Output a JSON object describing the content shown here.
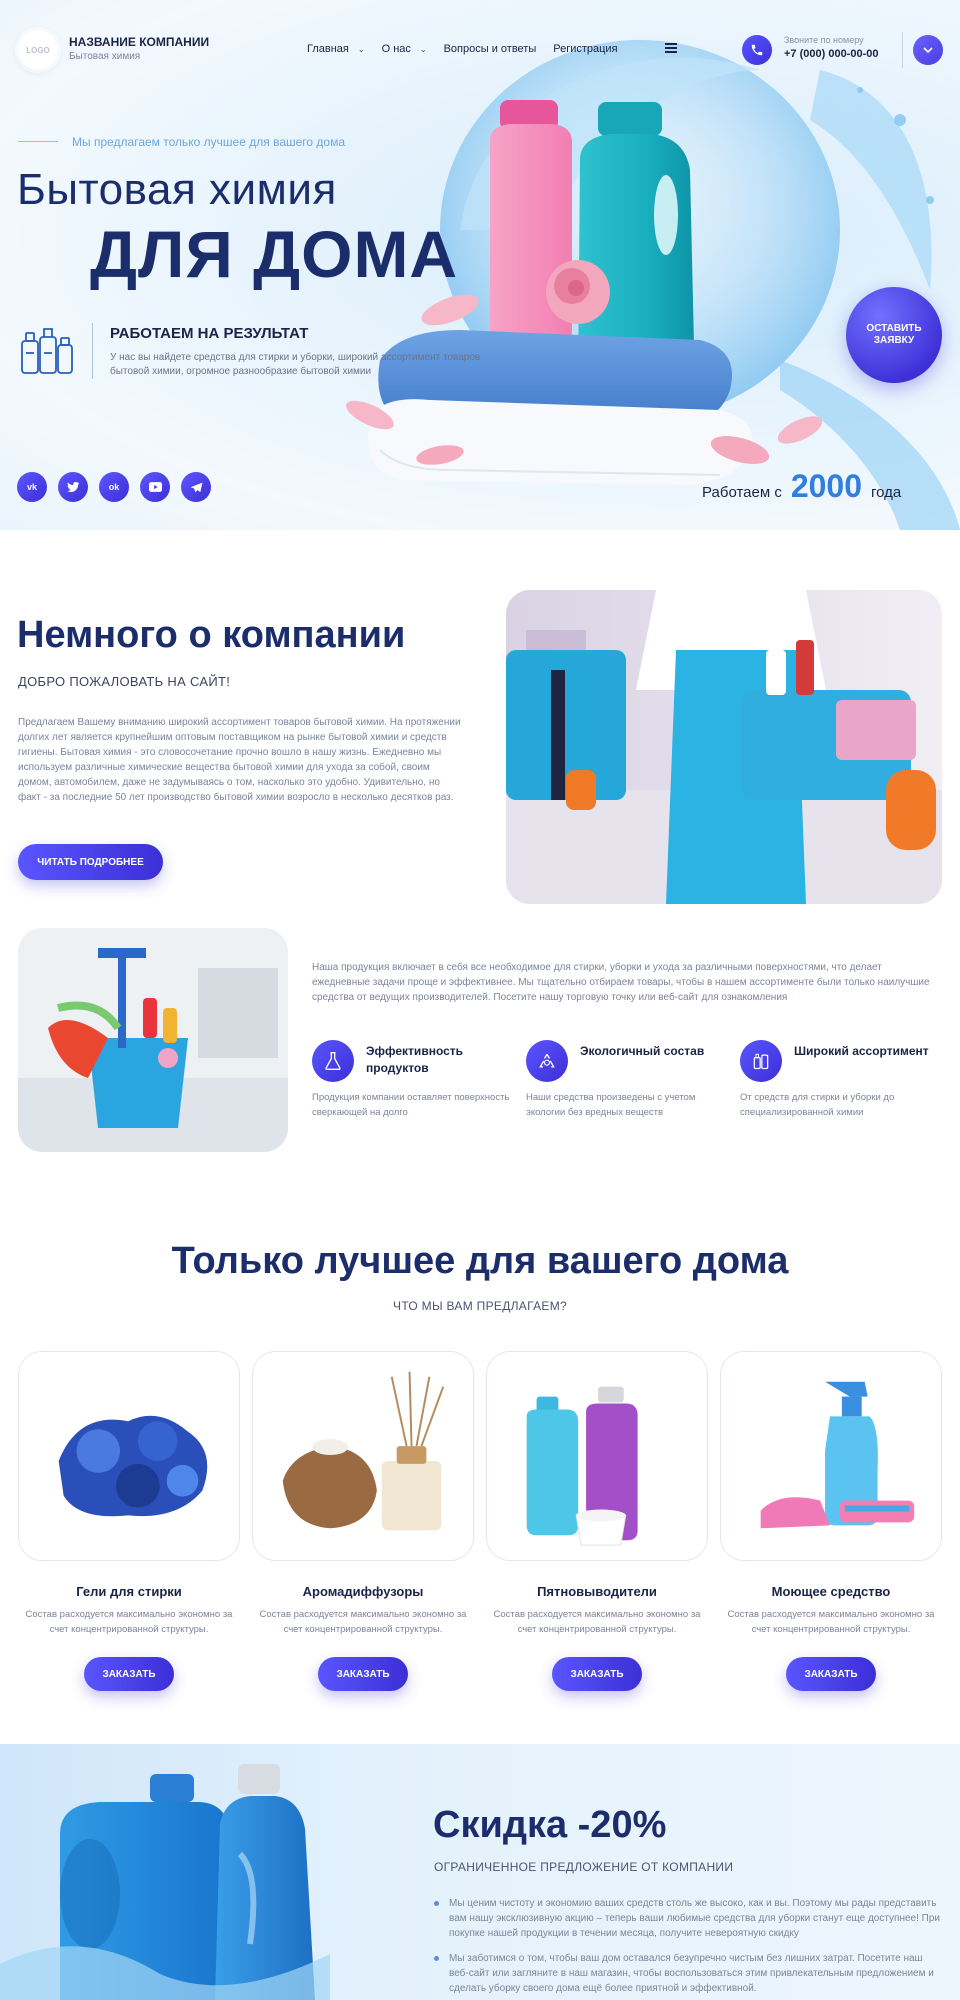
{
  "colors": {
    "accent": "#4a40e6",
    "title": "#1b2d6b",
    "highlight": "#2f7ee0"
  },
  "header": {
    "logo_text": "LOGO",
    "company_name": "НАЗВАНИЕ КОМПАНИИ",
    "company_sub": "Бытовая химия",
    "nav": [
      {
        "label": "Главная",
        "has_dropdown": true
      },
      {
        "label": "О нас",
        "has_dropdown": true
      },
      {
        "label": "Вопросы и ответы",
        "has_dropdown": false
      },
      {
        "label": "Регистрация",
        "has_dropdown": false
      }
    ],
    "menu_icon": "burger-icon",
    "phone_icon": "phone-icon",
    "phone_label": "Звоните по номеру",
    "phone_number": "+7 (000) 000-00-00",
    "dropdown_icon": "chevron-down-icon"
  },
  "hero": {
    "tagline": "Мы предлагаем только лучшее для вашего дома",
    "title_line1": "Бытовая химия",
    "title_line2": "ДЛЯ ДОМА",
    "feature_title": "РАБОТАЕМ НА РЕЗУЛЬТАТ",
    "feature_text": "У нас вы найдете средства для стирки и уборки, широкий ассортимент товаров бытовой химии, огромное разнообразие бытовой химии",
    "cta_label": "ОСТАВИТЬ ЗАЯВКУ",
    "socials": [
      "vk",
      "twitter",
      "ok",
      "youtube",
      "telegram"
    ],
    "social_icons": [
      "vk-icon",
      "twitter-icon",
      "odnoklassniki-icon",
      "youtube-icon",
      "telegram-icon"
    ],
    "since_prefix": "Работаем с",
    "since_year": "2000",
    "since_suffix": "года"
  },
  "about": {
    "title": "Немного о компании",
    "subtitle": "ДОБРО ПОЖАЛОВАТЬ НА САЙТ!",
    "text": "Предлагаем Вашему вниманию широкий ассортимент товаров бытовой химии. На протяжении долгих лет является крупнейшим оптовым поставщиком на рынке бытовой химии и средств гигиены. Бытовая химия - это словосочетание прочно вошло в нашу жизнь. Ежедневно мы используем различные химические вещества бытовой химии для ухода за собой, своим домом, автомобилем, даже не задумываясь о том, насколько это удобно. Удивительно, но факт - за последние 50 лет производство бытовой химии возросло в несколько десятков раз.",
    "button": "ЧИТАТЬ ПОДРОБНЕЕ"
  },
  "products_info": {
    "text": "Наша продукция включает в себя все необходимое для стирки, уборки и ухода за различными поверхностями, что делает ежедневные задачи проще и эффективнее. Мы тщательно отбираем товары, чтобы в нашем ассортименте были только наилучшие средства от ведущих производителей. Посетите нашу торговую точку или веб-сайт для ознакомления",
    "benefits": [
      {
        "icon": "flask-icon",
        "title": "Эффективность продуктов",
        "text": "Продукция компании оставляет поверхность сверкающей на долго"
      },
      {
        "icon": "recycle-icon",
        "title": "Экологичный состав",
        "text": "Наши средства произведены с учетом экологии без вредных веществ"
      },
      {
        "icon": "bottles-icon",
        "title": "Широкий ассортимент",
        "text": "От средств для стирки и уборки до специализированной химии"
      }
    ]
  },
  "offer": {
    "title": "Только лучшее для вашего дома",
    "subtitle": "ЧТО МЫ ВАМ ПРЕДЛАГАЕМ?",
    "cards": [
      {
        "title": "Гели для стирки",
        "text": "Состав расходуется максимально экономно за счет концентрированной структуры.",
        "button": "ЗАКАЗАТЬ"
      },
      {
        "title": "Аромадиффузоры",
        "text": "Состав расходуется максимально экономно за счет концентрированной структуры.",
        "button": "ЗАКАЗАТЬ"
      },
      {
        "title": "Пятновыводители",
        "text": "Состав расходуется максимально экономно за счет концентрированной структуры.",
        "button": "ЗАКАЗАТЬ"
      },
      {
        "title": "Моющее средство",
        "text": "Состав расходуется максимально экономно за счет концентрированной структуры.",
        "button": "ЗАКАЗАТЬ"
      }
    ]
  },
  "discount": {
    "title": "Скидка -20%",
    "subtitle": "ОГРАНИЧЕННОЕ ПРЕДЛОЖЕНИЕ ОТ КОМПАНИИ",
    "items": [
      "Мы ценим чистоту и экономию ваших средств столь же высоко, как и вы. Поэтому мы рады представить вам нашу эксклюзивную акцию – теперь ваши любимые средства для уборки станут еще доступнее! При покупке нашей продукции в течении месяца, получите невероятную скидку",
      "Мы заботимся о том, чтобы ваш дом оставался безупречно чистым без лишних затрат. Посетите наш веб-сайт или загляните в наш магазин, чтобы воспользоваться этим привлекательным предложением и сделать уборку своего дома ещё более приятной и эффективной."
    ]
  }
}
